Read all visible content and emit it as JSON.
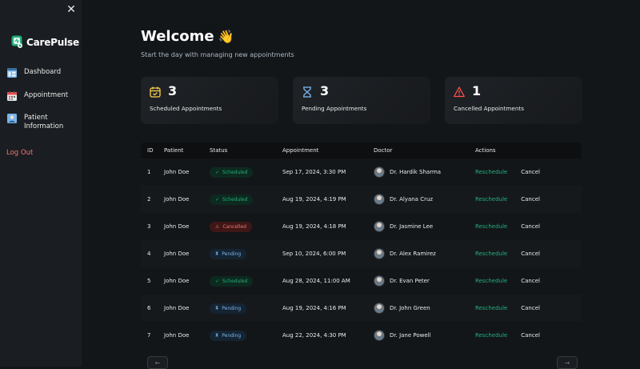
{
  "app": {
    "name": "CarePulse"
  },
  "sidebar": {
    "close_icon": "close-icon",
    "items": [
      {
        "label": "Dashboard",
        "icon": "dashboard-icon"
      },
      {
        "label": "Appointment",
        "icon": "calendar-icon"
      },
      {
        "label": "Patient Information",
        "icon": "patient-info-icon"
      }
    ],
    "logout_label": "Log Out"
  },
  "header": {
    "title": "Welcome",
    "emoji": "👋",
    "subtitle": "Start the day with managing new appointments"
  },
  "stats": [
    {
      "count": "3",
      "label": "Scheduled Appointments",
      "icon": "calendar-icon",
      "color": "#ffd147"
    },
    {
      "count": "3",
      "label": "Pending Appointments",
      "icon": "hourglass-icon",
      "color": "#79b5ec"
    },
    {
      "count": "1",
      "label": "Cancelled Appointments",
      "icon": "warning-icon",
      "color": "#ff4f4e"
    }
  ],
  "table": {
    "columns": [
      "ID",
      "Patient",
      "Status",
      "Appointment",
      "Doctor",
      "Actions"
    ],
    "rows": [
      {
        "id": "1",
        "patient": "John Doe",
        "status": "Scheduled",
        "appointment": "Sep 17, 2024, 3:30 PM",
        "doctor": "Dr. Hardik Sharma",
        "reschedule": "Reschedule",
        "cancel": "Cancel"
      },
      {
        "id": "2",
        "patient": "John Doe",
        "status": "Scheduled",
        "appointment": "Aug 19, 2024, 4:19 PM",
        "doctor": "Dr. Alyana Cruz",
        "reschedule": "Reschedule",
        "cancel": "Cancel"
      },
      {
        "id": "3",
        "patient": "John Doe",
        "status": "Cancelled",
        "appointment": "Aug 19, 2024, 4:18 PM",
        "doctor": "Dr. Jasmine Lee",
        "reschedule": "Reschedule",
        "cancel": "Cancel"
      },
      {
        "id": "4",
        "patient": "John Doe",
        "status": "Pending",
        "appointment": "Sep 10, 2024, 6:00 PM",
        "doctor": "Dr. Alex Ramirez",
        "reschedule": "Reschedule",
        "cancel": "Cancel"
      },
      {
        "id": "5",
        "patient": "John Doe",
        "status": "Scheduled",
        "appointment": "Aug 28, 2024, 11:00 AM",
        "doctor": "Dr. Evan Peter",
        "reschedule": "Reschedule",
        "cancel": "Cancel"
      },
      {
        "id": "6",
        "patient": "John Doe",
        "status": "Pending",
        "appointment": "Aug 19, 2024, 4:16 PM",
        "doctor": "Dr. John Green",
        "reschedule": "Reschedule",
        "cancel": "Cancel"
      },
      {
        "id": "7",
        "patient": "John Doe",
        "status": "Pending",
        "appointment": "Aug 22, 2024, 4:30 PM",
        "doctor": "Dr. Jane Powell",
        "reschedule": "Reschedule",
        "cancel": "Cancel"
      }
    ]
  },
  "pagination": {
    "prev": "←",
    "next": "→"
  },
  "colors": {
    "background": "#131619",
    "sidebar": "#1a1d21",
    "accent_green": "#24ae7c",
    "accent_blue": "#79b5ec",
    "accent_red": "#f37877"
  }
}
